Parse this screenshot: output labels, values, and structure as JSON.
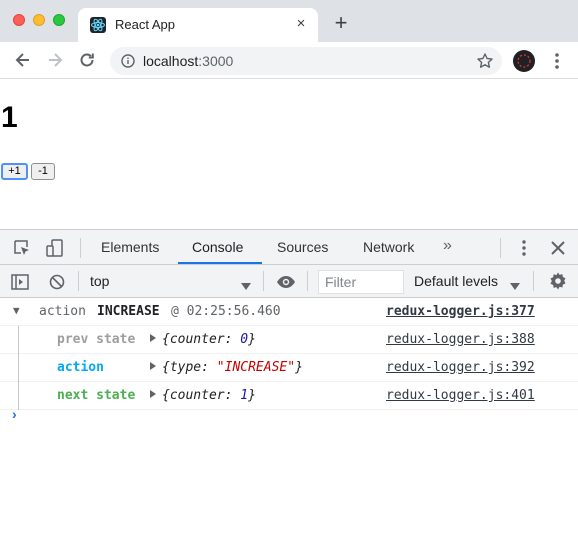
{
  "browser": {
    "tab_title": "React App",
    "tab_close": "×",
    "new_tab": "+",
    "url_host": "localhost",
    "url_port": ":3000"
  },
  "page": {
    "counter_value": "1",
    "increment_label": "+1",
    "decrement_label": "-1"
  },
  "devtools": {
    "tabs": [
      "Elements",
      "Console",
      "Sources",
      "Network"
    ],
    "active_tab": "Console",
    "more_tabs": "»",
    "context": "top",
    "filter_placeholder": "Filter",
    "levels_label": "Default levels",
    "log": {
      "header_type": "action",
      "header_name": "INCREASE",
      "header_time": "@ 02:25:56.460",
      "header_source": "redux-logger.js:377",
      "rows": [
        {
          "key": "prev state",
          "key_color": "#9e9e9e",
          "source": "redux-logger.js:388"
        },
        {
          "key": "action",
          "key_color": "#03a9f4",
          "source": "redux-logger.js:392"
        },
        {
          "key": "next state",
          "key_color": "#4caf50",
          "source": "redux-logger.js:401"
        }
      ],
      "prev_state": {
        "field": "counter",
        "value": "0"
      },
      "action": {
        "field": "type",
        "value": "\"INCREASE\""
      },
      "next_state": {
        "field": "counter",
        "value": "1"
      }
    },
    "prompt_symbol": "›"
  }
}
